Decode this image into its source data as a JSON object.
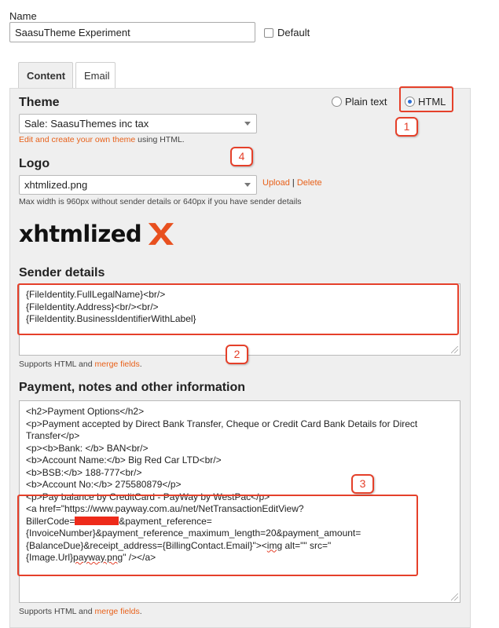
{
  "form": {
    "name_label": "Name",
    "name_value": "SaasuTheme Experiment",
    "default_label": "Default"
  },
  "tabs": [
    {
      "label": "Content",
      "active": true
    },
    {
      "label": "Email",
      "active": false
    }
  ],
  "theme": {
    "title": "Theme",
    "plain_text_label": "Plain text",
    "html_label": "HTML",
    "selected_format": "HTML",
    "select_value": "Sale: SaasuThemes inc tax",
    "edit_link": "Edit and create your own theme",
    "edit_suffix": " using HTML."
  },
  "logo": {
    "title": "Logo",
    "select_value": "xhtmlized.png",
    "upload_link": "Upload",
    "separator": "|",
    "delete_link": "Delete",
    "hint": "Max width is 960px without sender details or 640px if you have sender details",
    "image_text": "xhtmlized"
  },
  "sender": {
    "title": "Sender details",
    "lines": [
      "{FileIdentity.FullLegalName}<br/>",
      "{FileIdentity.Address}<br/><br/>",
      "{FileIdentity.BusinessIdentifierWithLabel}"
    ],
    "supports_prefix": "Supports HTML and ",
    "merge_link": "merge fields",
    "supports_suffix": "."
  },
  "payment": {
    "title": "Payment, notes and other information",
    "lines": [
      "<h2>Payment Options</h2>",
      "<p>Payment accepted by Direct Bank Transfer, Cheque or Credit Card Bank Details for Direct Transfer</p>",
      "<p><b>Bank: </b> BAN<br/>",
      "<b>Account Name:</b> Big Red Car LTD<br/>",
      "<b>BSB:</b> 188-777<br/>",
      "<b>Account No:</b> 275580879</p>",
      "<p>Pay balance by CreditCard - PayWay by WestPac</p>"
    ],
    "link_line1": "<a href=\"https://www.payway.com.au/net/NetTransactionEditView?",
    "link_line2_prefix": "BillerCode=",
    "link_line2_suffix": "&payment_reference=",
    "link_line3": "{InvoiceNumber}&payment_reference_maximum_length=20&payment_amount=",
    "link_line4_prefix": "{BalanceDue}&receipt_address={BillingContact.Email}\"><",
    "link_line4_img": "img",
    "link_line4_suffix": " alt=\"\" src=\"",
    "link_line5_prefix": "{Image.Url}",
    "link_line5_png": "payway.png",
    "link_line5_suffix": "\" /></a>",
    "supports_prefix": "Supports HTML and ",
    "merge_link": "merge fields",
    "supports_suffix": "."
  },
  "callouts": [
    "1",
    "2",
    "3",
    "4"
  ],
  "colors": {
    "accent_link": "#e8611a",
    "annotation_red": "#e5402a",
    "logo_x": "#e8501f"
  }
}
